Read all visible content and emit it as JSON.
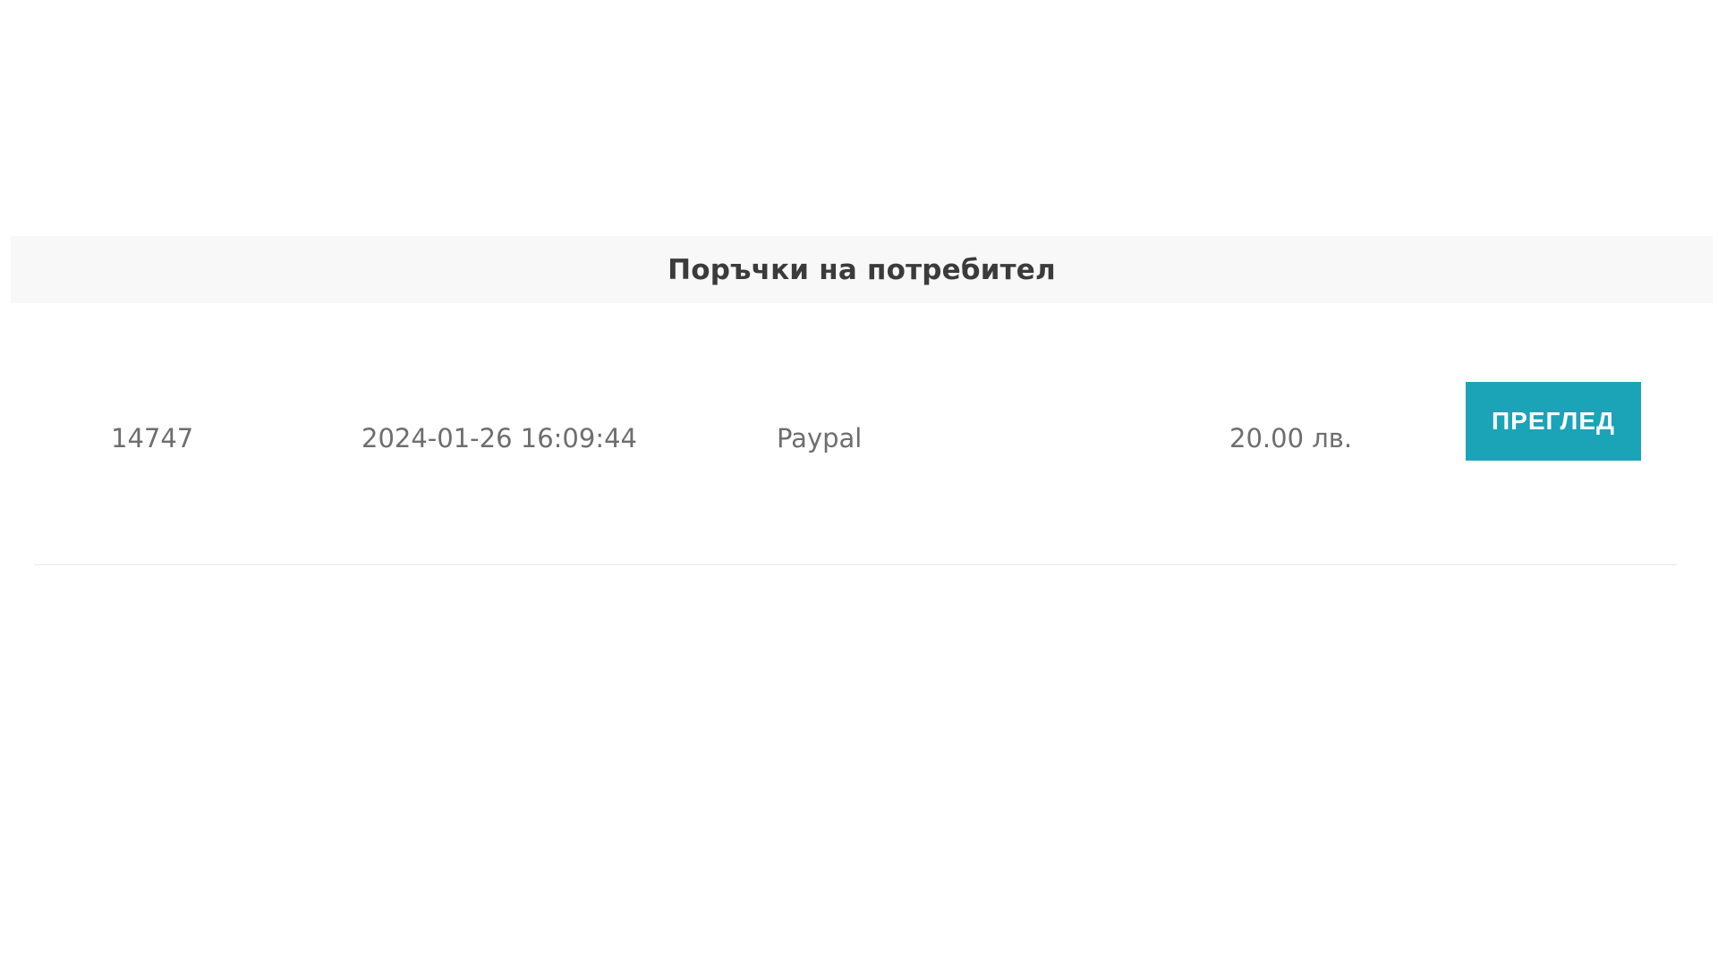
{
  "panel": {
    "title": "Поръчки на потребител"
  },
  "orders": [
    {
      "id": "14747",
      "date": "2024-01-26 16:09:44",
      "payment_method": "Paypal",
      "total": "20.00 лв.",
      "action_label": "ПРЕГЛЕД"
    }
  ],
  "colors": {
    "accent": "#1ba3b7",
    "header_background": "#f8f8f8",
    "text": "#6e6e6e",
    "title": "#3b3b3b"
  }
}
